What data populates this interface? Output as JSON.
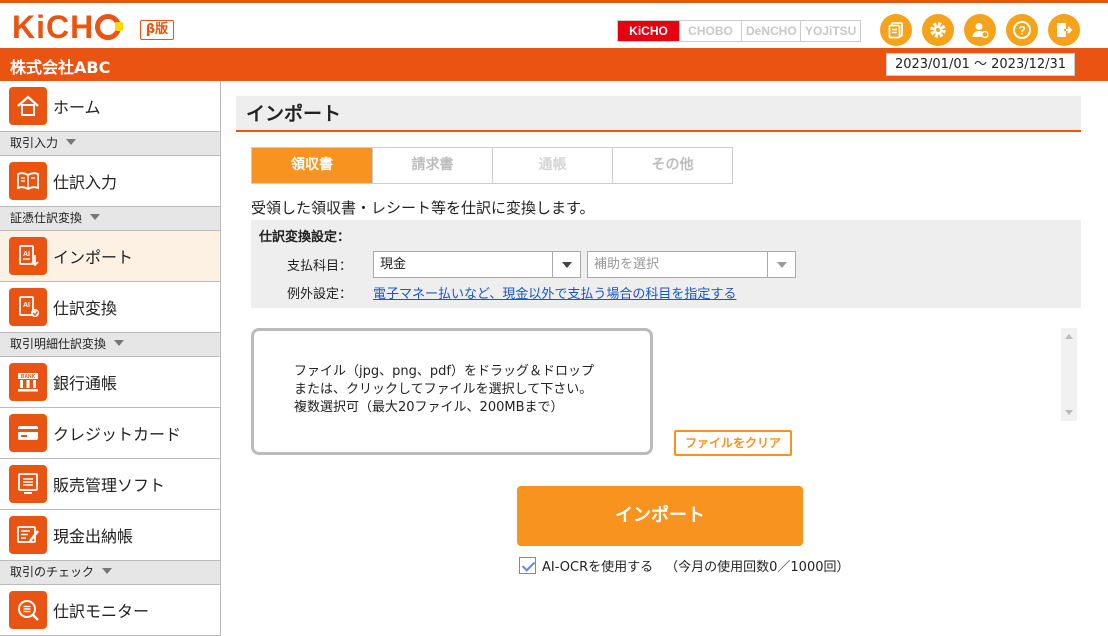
{
  "header": {
    "logo": "KiCHO",
    "beta_label": "β版",
    "products": [
      "KiCHO",
      "CHOBO",
      "DeNCHO",
      "YOJiTSU"
    ],
    "active_product": "KiCHO",
    "icons": [
      "document-icon",
      "gear-icon",
      "user-settings-icon",
      "help-icon",
      "logout-icon"
    ]
  },
  "company": {
    "name": "株式会社ABC",
    "period": "2023/01/01 ～ 2023/12/31"
  },
  "sidebar": {
    "home": "ホーム",
    "sections": [
      {
        "title": "取引入力",
        "items": [
          "仕訳入力"
        ]
      },
      {
        "title": "証憑仕訳変換",
        "items": [
          "インポート",
          "仕訳変換"
        ]
      },
      {
        "title": "取引明細仕訳変換",
        "items": [
          "銀行通帳",
          "クレジットカード",
          "販売管理ソフト",
          "現金出納帳"
        ]
      },
      {
        "title": "取引のチェック",
        "items": [
          "仕訳モニター"
        ]
      }
    ],
    "active_item": "インポート"
  },
  "main": {
    "title": "インポート",
    "tabs": [
      "領収書",
      "請求書",
      "通帳",
      "その他"
    ],
    "active_tab": "領収書",
    "description": "受領した領収書・レシート等を仕訳に変換します。",
    "settings": {
      "title": "仕訳変換設定：",
      "payment_label": "支払科目：",
      "payment_value": "現金",
      "sub_placeholder": "補助を選択",
      "exception_label": "例外設定：",
      "exception_link": "電子マネー払いなど、現金以外で支払う場合の科目を指定する"
    },
    "dropzone": {
      "line1": "ファイル（jpg、png、pdf）をドラッグ＆ドロップ",
      "line2": "または、クリックしてファイルを選択して下さい。",
      "line3": "複数選択可（最大20ファイル、200MBまで）"
    },
    "clear_button": "ファイルをクリア",
    "import_button": "インポート",
    "ocr": {
      "checked": true,
      "label": "AI-OCRを使用する",
      "usage": "（今月の使用回数0／1000回）"
    }
  },
  "colors": {
    "brand": "#ea5412",
    "accent": "#f7931e",
    "link": "#1a56c8"
  }
}
